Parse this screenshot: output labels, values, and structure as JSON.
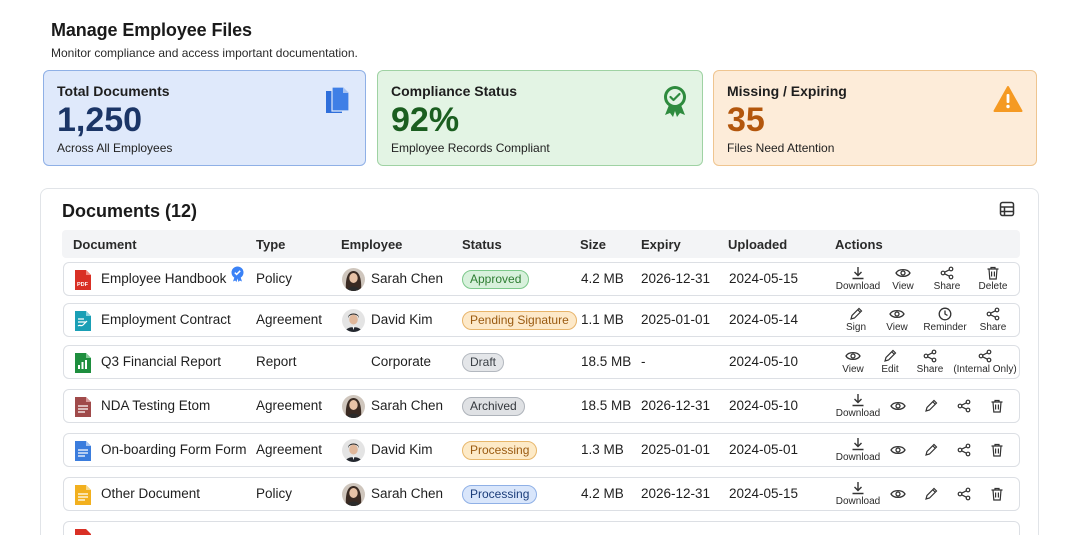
{
  "header": {
    "title": "Manage Employee Files",
    "subtitle": "Monitor compliance and access important documentation."
  },
  "cards": {
    "documents": {
      "label": "Total Documents",
      "value": "1,250",
      "caption": "Across All Employees",
      "icon": "document-stack-icon"
    },
    "compliance": {
      "label": "Compliance Status",
      "value": "92%",
      "caption": "Employee Records Compliant",
      "icon": "award-check-icon"
    },
    "missing": {
      "label": "Missing / Expiring",
      "value": "35",
      "caption": "Files Need Attention",
      "icon": "warning-triangle-icon"
    }
  },
  "panel": {
    "title": "Documents (12)",
    "columns": [
      "Document",
      "Type",
      "Employee",
      "Status",
      "Size",
      "Expiry",
      "Uploaded",
      "Actions"
    ]
  },
  "rows": [
    {
      "document": "Employee Handbook",
      "type": "Policy",
      "employee": "Sarah Chen",
      "status": "Approved",
      "size": "4.2 MB",
      "expiry": "2026-12-31",
      "uploaded": "2024-05-15",
      "actions": [
        "Download",
        "View",
        "Share",
        "Delete"
      ]
    },
    {
      "document": "Employment Contract",
      "type": "Agreement",
      "employee": "David Kim",
      "status": "Pending Signature",
      "size": "1.1 MB",
      "expiry": "2025-01-01",
      "uploaded": "2024-05-14",
      "actions": [
        "Sign",
        "View",
        "Reminder",
        "Share"
      ]
    },
    {
      "document": "Q3 Financial Report",
      "type": "Report",
      "employee": "Corporate",
      "status": "Draft",
      "size": "18.5 MB",
      "expiry": "-",
      "uploaded": "2024-05-10",
      "actions": [
        "View",
        "Edit",
        "Share",
        "(Internal Only)"
      ]
    },
    {
      "document": "NDA Testing Etom",
      "type": "Agreement",
      "employee": "Sarah Chen",
      "status": "Archived",
      "size": "18.5 MB",
      "expiry": "2026-12-31",
      "uploaded": "2024-05-10",
      "actions": [
        "Download"
      ]
    },
    {
      "document": "On-boarding Form Form",
      "type": "Agreement",
      "employee": "David Kim",
      "status": "Processing",
      "size": "1.3 MB",
      "expiry": "2025-01-01",
      "uploaded": "2024-05-01",
      "actions": [
        "Download"
      ]
    },
    {
      "document": "Other Document",
      "type": "Policy",
      "employee": "Sarah Chen",
      "status": "Processing",
      "size": "4.2 MB",
      "expiry": "2026-12-31",
      "uploaded": "2024-05-15",
      "actions": [
        "Download"
      ]
    }
  ],
  "colors": {
    "accent_blue": "#2f6fdb",
    "success_green": "#2e7d32",
    "warning_orange": "#f59a23"
  }
}
